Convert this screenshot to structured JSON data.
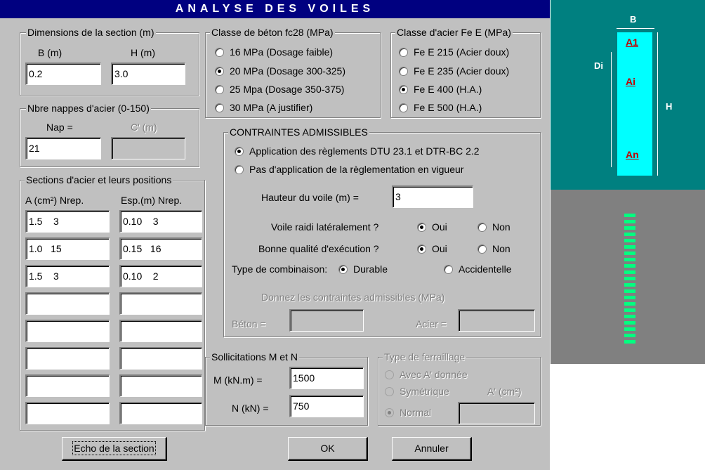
{
  "dialog": {
    "title": "ANALYSE DES VOILES",
    "dimensions": {
      "legend": "Dimensions de la section (m)",
      "b_label": "B (m)",
      "h_label": "H (m)",
      "b_value": "0.2",
      "h_value": "3.0"
    },
    "nappes": {
      "legend": "Nbre nappes d'acier (0-150)",
      "nap_label": "Nap =",
      "c_label": "C' (m)",
      "nap_value": "21",
      "c_value": ""
    },
    "sections": {
      "legend": "Sections d'acier et leurs positions",
      "col_a": "A (cm²) Nrep.",
      "col_esp": "Esp.(m)  Nrep.",
      "rows": [
        {
          "a": "1.5    3",
          "esp": "0.10    3"
        },
        {
          "a": "1.0   15",
          "esp": "0.15   16"
        },
        {
          "a": "1.5    3",
          "esp": "0.10    2"
        },
        {
          "a": "",
          "esp": ""
        },
        {
          "a": "",
          "esp": ""
        },
        {
          "a": "",
          "esp": ""
        },
        {
          "a": "",
          "esp": ""
        },
        {
          "a": "",
          "esp": ""
        }
      ]
    },
    "beton": {
      "legend": "Classe de béton fc28 (MPa)",
      "options": [
        {
          "label": "16 MPa (Dosage faible)",
          "selected": false
        },
        {
          "label": "20 MPa (Dosage 300-325)",
          "selected": true
        },
        {
          "label": "25 Mpa (Dosage 350-375)",
          "selected": false
        },
        {
          "label": "30 MPa (A justifier)",
          "selected": false
        }
      ]
    },
    "acier": {
      "legend": "Classe d'acier Fe E (MPa)",
      "options": [
        {
          "label": "Fe E 215 (Acier doux)",
          "selected": false
        },
        {
          "label": "Fe E 235 (Acier doux)",
          "selected": false
        },
        {
          "label": "Fe E 400 (H.A.)",
          "selected": true
        },
        {
          "label": "Fe E 500 (H.A.)",
          "selected": false
        }
      ]
    },
    "contraintes": {
      "legend": "CONTRAINTES ADMISSIBLES",
      "opt1": "Application des règlements DTU 23.1 et DTR-BC 2.2",
      "opt1_selected": true,
      "opt2": "Pas d'application de la règlementation en vigueur",
      "opt2_selected": false,
      "hauteur_label": "Hauteur du voile (m) =",
      "hauteur_value": "3",
      "raidi_label": "Voile raidi latéralement ?",
      "bonne_label": "Bonne qualité d'exécution ?",
      "oui": "Oui",
      "non": "Non",
      "type_label": "Type de combinaison:",
      "durable": "Durable",
      "accidentelle": "Accidentelle",
      "donnez_label": "Donnez les contraintes admissibles (MPa)",
      "beton_label": "Béton =",
      "acier_label": "Acier ="
    },
    "sollicitations": {
      "legend": "Sollicitations  M  et  N",
      "m_label": "M (kN.m) =",
      "m_value": "1500",
      "n_label": "N (kN) =",
      "n_value": "750"
    },
    "ferraillage": {
      "legend": "Type de ferraillage",
      "avec": "Avec A' donnée",
      "symetrique": "Symétrique",
      "a_prime": "A' (cm²)",
      "normal": "Normal"
    },
    "buttons": {
      "echo": "Echo de la section",
      "ok": "OK",
      "annuler": "Annuler"
    }
  },
  "diagram": {
    "b": "B",
    "h": "H",
    "di": "Di",
    "a1": "A1",
    "ai": "Ai",
    "an": "An",
    "section_color": "#00ffff",
    "panel_color": "#008080",
    "rebar_color": "#00ff80"
  }
}
